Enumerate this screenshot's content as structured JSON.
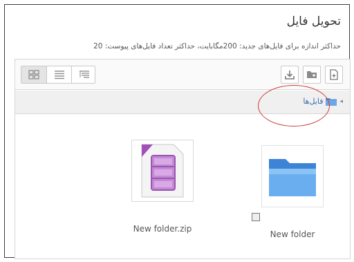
{
  "header": {
    "title": "تحویل فایل",
    "limits_text": "حداکثر اندازه برای فایل‌های جدید: 200مگابایت، حداکثر تعداد فایل‌های پیوست: 20"
  },
  "toolbar": {
    "left_buttons": [
      "view-icons-icon",
      "view-list-icon",
      "view-tree-icon"
    ],
    "right_buttons": [
      "download-icon",
      "create-folder-icon",
      "add-file-icon"
    ]
  },
  "breadcrumb": {
    "label": "فایل‌ها"
  },
  "files": [
    {
      "name": "New folder.zip",
      "type": "zip"
    },
    {
      "name": "New folder",
      "type": "folder"
    }
  ],
  "colors": {
    "highlight": "#d13a3a",
    "folder": "#5a9be0",
    "zip": "#b978c9"
  }
}
